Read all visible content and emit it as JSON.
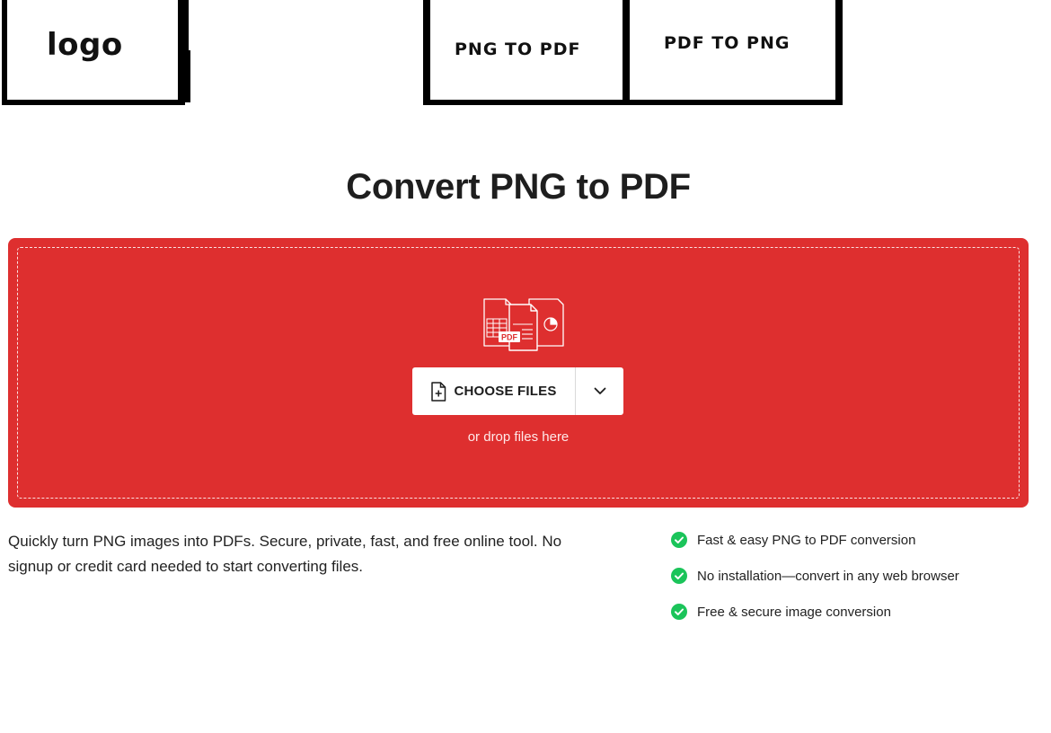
{
  "header": {
    "logo_text": "logo",
    "nav": [
      {
        "label": "PNG TO PDF"
      },
      {
        "label": "PDF TO PNG"
      }
    ]
  },
  "main": {
    "title": "Convert PNG to PDF",
    "upload": {
      "graphic_badge": "PDF",
      "choose_label": "CHOOSE FILES",
      "drop_hint": "or drop files here",
      "icons": {
        "choose": "file-add-icon",
        "dropdown": "chevron-down-icon"
      }
    },
    "description": "Quickly turn PNG images into PDFs. Secure, private, fast, and free online tool. No signup or credit card needed to start converting files.",
    "features": [
      {
        "text": "Fast & easy PNG to PDF conversion",
        "icon": "check-circle-icon"
      },
      {
        "text": "No installation—convert in any web browser",
        "icon": "check-circle-icon"
      },
      {
        "text": "Free & secure image conversion",
        "icon": "check-circle-icon"
      }
    ]
  },
  "colors": {
    "accent": "#de2f2f",
    "check": "#1bc45a",
    "text": "#1f1f1f"
  }
}
